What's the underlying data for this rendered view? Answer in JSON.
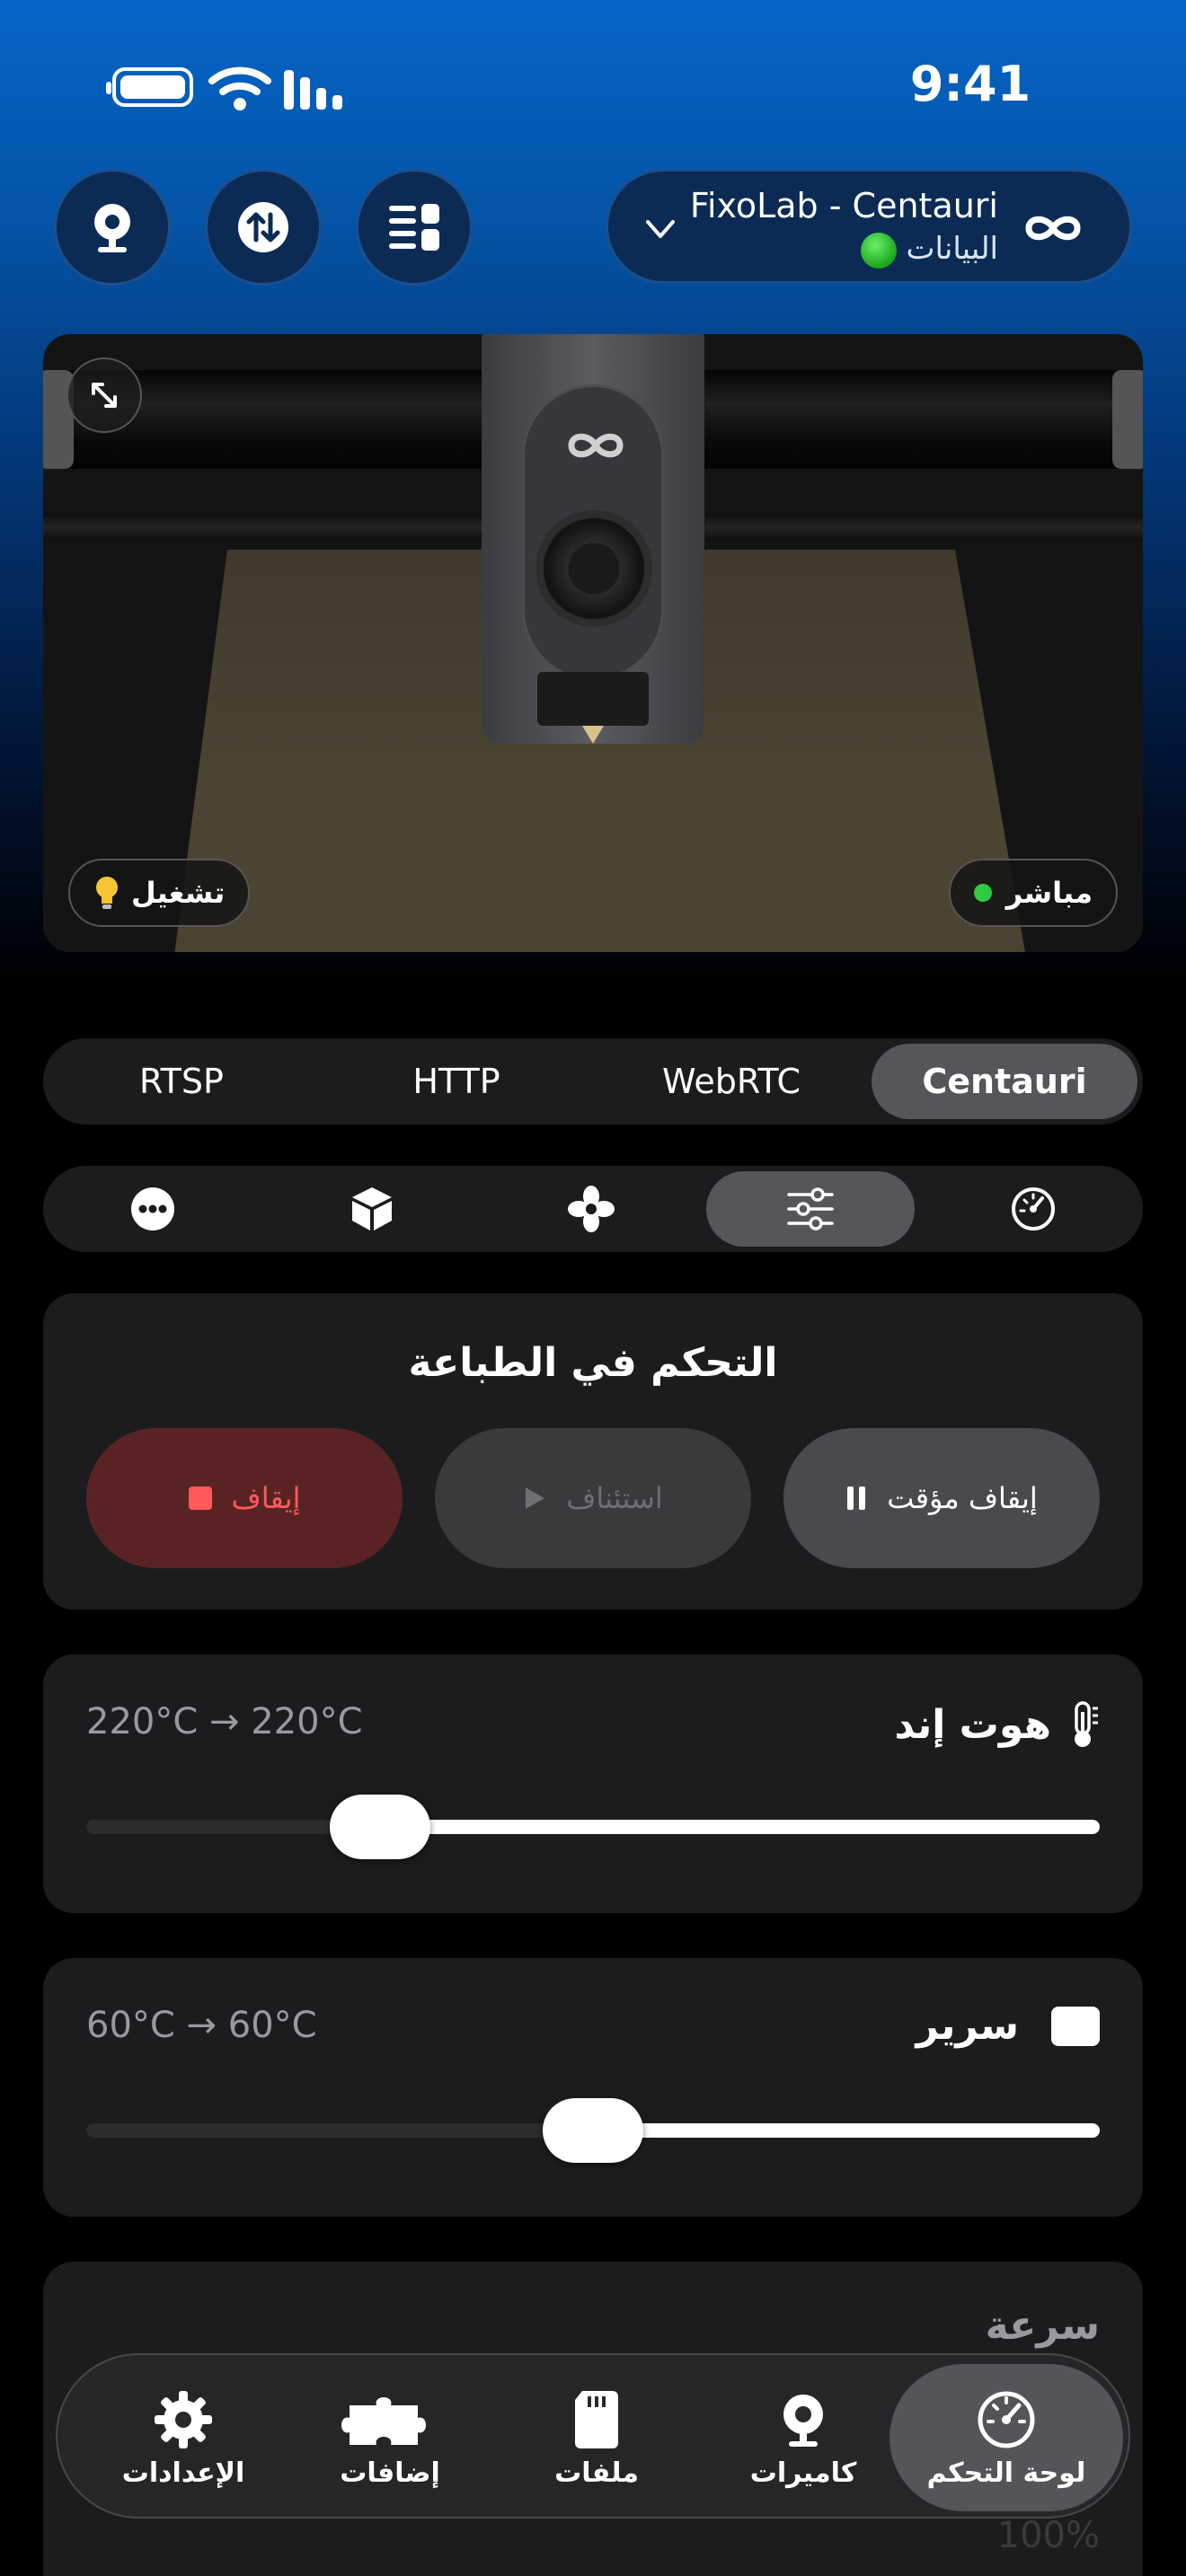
{
  "status_bar": {
    "time": "9:41"
  },
  "printer": {
    "name": "FixoLab - Centauri",
    "status": "البيانات",
    "status_color": "#22c322"
  },
  "top_buttons": [
    {
      "icon": "webcam-icon"
    },
    {
      "icon": "transfer-arrows-icon"
    },
    {
      "icon": "list-grid-icon"
    }
  ],
  "camera": {
    "live_label": "مباشر",
    "light_label": "تشغيل",
    "light_icon": "lightbulb-icon"
  },
  "stream_tabs": [
    "RTSP",
    "HTTP",
    "WebRTC",
    "Centauri"
  ],
  "stream_active": "Centauri",
  "control_tabs": [
    {
      "icon": "more-dots-icon"
    },
    {
      "icon": "box-icon"
    },
    {
      "icon": "fan-icon"
    },
    {
      "icon": "sliders-icon",
      "active": true
    },
    {
      "icon": "gauge-icon"
    }
  ],
  "print_control": {
    "title": "التحكم في الطباعة",
    "stop_label": "إيقاف",
    "resume_label": "استئناف",
    "pause_label": "إيقاف مؤقت"
  },
  "hotend": {
    "label": "هوت إند",
    "value": "220°C → 220°C",
    "level": 0.29
  },
  "bed": {
    "label": "سرير",
    "value": "60°C → 60°C",
    "level": 0.5
  },
  "speed": {
    "label": "سرعة",
    "value": "100%"
  },
  "tab_bar": [
    {
      "label": "الإعدادات",
      "icon": "gear-icon"
    },
    {
      "label": "إضافات",
      "icon": "puzzle-icon"
    },
    {
      "label": "ملفات",
      "icon": "sd-card-icon"
    },
    {
      "label": "كاميرات",
      "icon": "webcam-icon"
    },
    {
      "label": "لوحة التحكم",
      "icon": "dashboard-gauge-icon",
      "active": true
    }
  ],
  "colors": {
    "accent": "#0565c6",
    "stop": "#ff5a5a",
    "card": "#1c1c1e"
  }
}
